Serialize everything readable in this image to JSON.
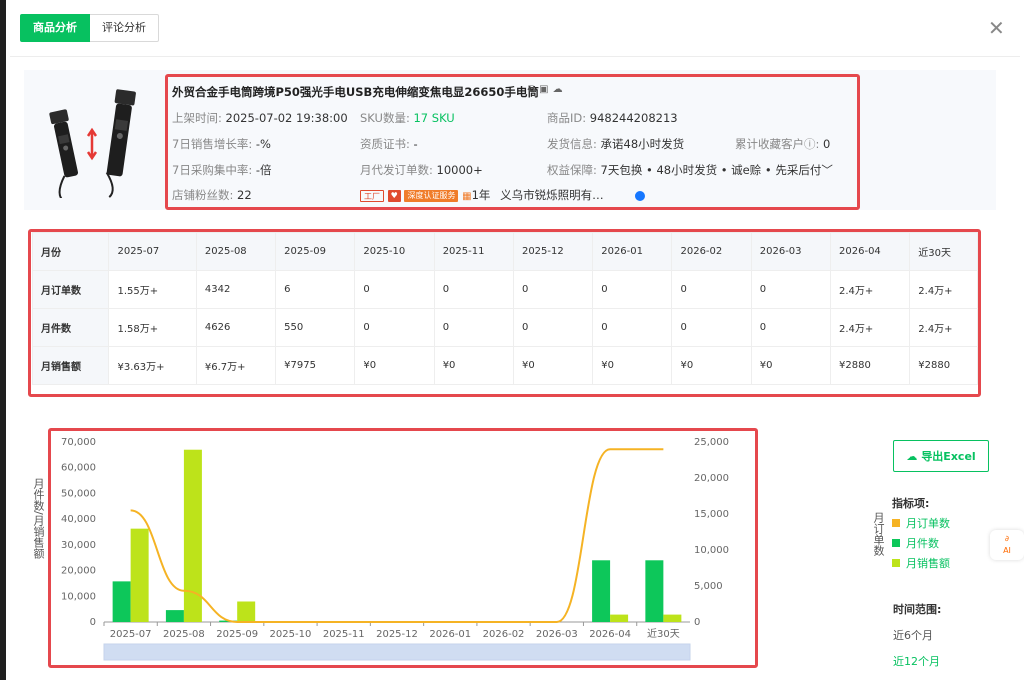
{
  "tabs": [
    {
      "label": "商品分析",
      "active": true
    },
    {
      "label": "评论分析",
      "active": false
    }
  ],
  "product": {
    "title": "外贸合金手电筒跨境P50强光手电USB充电伸缩变焦电显26650手电筒",
    "listed_label": "上架时间:",
    "listed_value": "2025-07-02 19:38:00",
    "sku_label": "SKU数量:",
    "sku_value": "17 SKU",
    "id_label": "商品ID:",
    "id_value": "948244208213",
    "growth_label": "7日销售增长率:",
    "growth_value": "-%",
    "cert_label": "资质证书:",
    "cert_value": "-",
    "ship_label": "发货信息:",
    "ship_value": "承诺48小时发货",
    "fav_label": "累计收藏客户",
    "fav_value": "0",
    "purchase_label": "7日采购集中率:",
    "purchase_value": "-倍",
    "dropship_label": "月代发订单数:",
    "dropship_value": "10000+",
    "rights_label": "权益保障:",
    "rights_value": "7天包换 • 48小时发货 • 诚e赊 • 先采后付",
    "fans_label": "店铺粉丝数:",
    "fans_value": "22",
    "badge_factory": "工厂",
    "badge_cert": "深度认证服务",
    "years": "1年",
    "shop_name": "义乌市锐烁照明有…"
  },
  "table": {
    "header": [
      "月份",
      "2025-07",
      "2025-08",
      "2025-09",
      "2025-10",
      "2025-11",
      "2025-12",
      "2026-01",
      "2026-02",
      "2026-03",
      "2026-04",
      "近30天"
    ],
    "rows": [
      [
        "月订单数",
        "1.55万+",
        "4342",
        "6",
        "0",
        "0",
        "0",
        "0",
        "0",
        "0",
        "2.4万+",
        "2.4万+"
      ],
      [
        "月件数",
        "1.58万+",
        "4626",
        "550",
        "0",
        "0",
        "0",
        "0",
        "0",
        "0",
        "2.4万+",
        "2.4万+"
      ],
      [
        "月销售额",
        "¥3.63万+",
        "¥6.7万+",
        "¥7975",
        "¥0",
        "¥0",
        "¥0",
        "¥0",
        "¥0",
        "¥0",
        "¥2880",
        "¥2880"
      ]
    ]
  },
  "chart_data": {
    "type": "bar",
    "categories": [
      "2025-07",
      "2025-08",
      "2025-09",
      "2025-10",
      "2025-11",
      "2025-12",
      "2026-01",
      "2026-02",
      "2026-03",
      "2026-04",
      "近30天"
    ],
    "series": [
      {
        "name": "月订单数",
        "kind": "line",
        "axis": "right",
        "color": "#f5b324",
        "values": [
          15500,
          4342,
          6,
          0,
          0,
          0,
          0,
          0,
          0,
          24000,
          24000
        ]
      },
      {
        "name": "月件数",
        "kind": "bar",
        "axis": "left",
        "color": "#0dc75a",
        "values": [
          15800,
          4626,
          550,
          0,
          0,
          0,
          0,
          0,
          0,
          24000,
          24000
        ]
      },
      {
        "name": "月销售额",
        "kind": "bar",
        "axis": "left",
        "color": "#bde31a",
        "values": [
          36300,
          67000,
          7975,
          0,
          0,
          0,
          0,
          0,
          0,
          2880,
          2880
        ]
      }
    ],
    "ylabel_left": "月件数/月销售额",
    "ylabel_right": "月订单数",
    "ylim_left": [
      0,
      70000
    ],
    "ylim_right": [
      0,
      25000
    ],
    "yticks_left": [
      "0",
      "10,000",
      "20,000",
      "30,000",
      "40,000",
      "50,000",
      "60,000",
      "70,000"
    ],
    "yticks_right": [
      "0",
      "5,000",
      "10,000",
      "15,000",
      "20,000",
      "25,000"
    ],
    "grid": false
  },
  "side": {
    "export_label": "导出Excel",
    "legend_title": "指标项:",
    "range_title": "时间范围:",
    "range_options": [
      "近6个月",
      "近12个月"
    ],
    "range_selected": "近12个月"
  },
  "colors": {
    "accent": "#07c160",
    "highlight": "#e5484d"
  }
}
